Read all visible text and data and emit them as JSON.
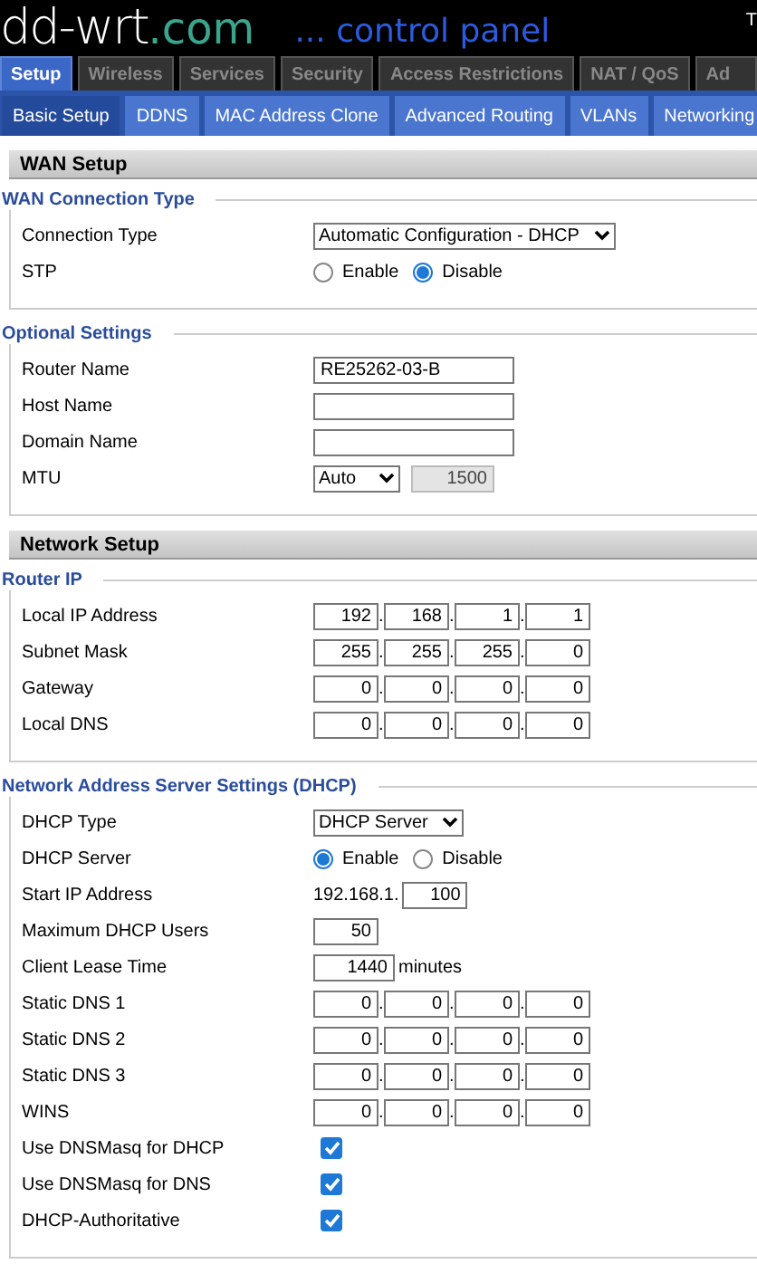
{
  "header": {
    "logo_main": "dd-wrt",
    "logo_suffix": ".com",
    "tagline": "... control panel",
    "corner_text": "T"
  },
  "tabs": [
    {
      "label": "Setup",
      "selected": true
    },
    {
      "label": "Wireless",
      "selected": false
    },
    {
      "label": "Services",
      "selected": false
    },
    {
      "label": "Security",
      "selected": false
    },
    {
      "label": "Access Restrictions",
      "selected": false
    },
    {
      "label": "NAT / QoS",
      "selected": false
    },
    {
      "label": "Ad",
      "selected": false
    }
  ],
  "subtabs": [
    {
      "label": "Basic Setup",
      "selected": true
    },
    {
      "label": "DDNS",
      "selected": false
    },
    {
      "label": "MAC Address Clone",
      "selected": false
    },
    {
      "label": "Advanced Routing",
      "selected": false
    },
    {
      "label": "VLANs",
      "selected": false
    },
    {
      "label": "Networking",
      "selected": false
    }
  ],
  "sections": [
    {
      "title": "WAN Setup",
      "fieldsets": [
        {
          "legend": "WAN Connection Type",
          "rows": [
            {
              "label": "Connection Type",
              "kind": "select",
              "value": "Automatic Configuration - DHCP"
            },
            {
              "label": "STP",
              "kind": "radio",
              "options": [
                {
                  "label": "Enable",
                  "selected": false
                },
                {
                  "label": "Disable",
                  "selected": true
                }
              ]
            }
          ]
        },
        {
          "legend": "Optional Settings",
          "rows": [
            {
              "label": "Router Name",
              "kind": "text",
              "value": "RE25262-03-B"
            },
            {
              "label": "Host Name",
              "kind": "text"
            },
            {
              "label": "Domain Name",
              "kind": "text"
            },
            {
              "label": "MTU",
              "kind": "select",
              "value": "Auto",
              "extra": {
                "value": "1500",
                "disabled": true
              }
            }
          ]
        }
      ]
    },
    {
      "title": "Network Setup",
      "fieldsets": [
        {
          "legend": "Router IP",
          "rows": [
            {
              "label": "Local IP Address",
              "kind": "ip",
              "separator": ".",
              "octets": [
                "192",
                "168",
                "1",
                "1"
              ]
            },
            {
              "label": "Subnet Mask",
              "kind": "ip",
              "separator": ".",
              "octets": [
                "255",
                "255",
                "255",
                "0"
              ]
            },
            {
              "label": "Gateway",
              "kind": "ip",
              "separator": ".",
              "octets": [
                "0",
                "0",
                "0",
                "0"
              ]
            },
            {
              "label": "Local DNS",
              "kind": "ip",
              "separator": ".",
              "octets": [
                "0",
                "0",
                "0",
                "0"
              ]
            }
          ]
        },
        {
          "legend": "Network Address Server Settings (DHCP)",
          "rows": [
            {
              "label": "DHCP Type",
              "kind": "select",
              "value": "DHCP Server"
            },
            {
              "label": "DHCP Server",
              "kind": "radio",
              "options": [
                {
                  "label": "Enable",
                  "selected": true
                },
                {
                  "label": "Disable",
                  "selected": false
                }
              ]
            },
            {
              "label": "Start IP Address",
              "kind": "number",
              "prefix": "192.168.1.",
              "value": "100"
            },
            {
              "label": "Maximum DHCP Users",
              "kind": "number",
              "value": "50"
            },
            {
              "label": "Client Lease Time",
              "kind": "number",
              "value": "1440",
              "suffix": "minutes"
            },
            {
              "label": "Static DNS 1",
              "kind": "ip",
              "separator": ".",
              "octets": [
                "0",
                "0",
                "0",
                "0"
              ]
            },
            {
              "label": "Static DNS 2",
              "kind": "ip",
              "separator": ".",
              "octets": [
                "0",
                "0",
                "0",
                "0"
              ]
            },
            {
              "label": "Static DNS 3",
              "kind": "ip",
              "separator": ".",
              "octets": [
                "0",
                "0",
                "0",
                "0"
              ]
            },
            {
              "label": "WINS",
              "kind": "ip",
              "separator": ".",
              "octets": [
                "0",
                "0",
                "0",
                "0"
              ]
            },
            {
              "label": "Use DNSMasq for DHCP",
              "kind": "checkbox",
              "checked": true
            },
            {
              "label": "Use DNSMasq for DNS",
              "kind": "checkbox",
              "checked": true
            },
            {
              "label": "DHCP-Authoritative",
              "kind": "checkbox",
              "checked": true
            }
          ]
        }
      ]
    }
  ]
}
